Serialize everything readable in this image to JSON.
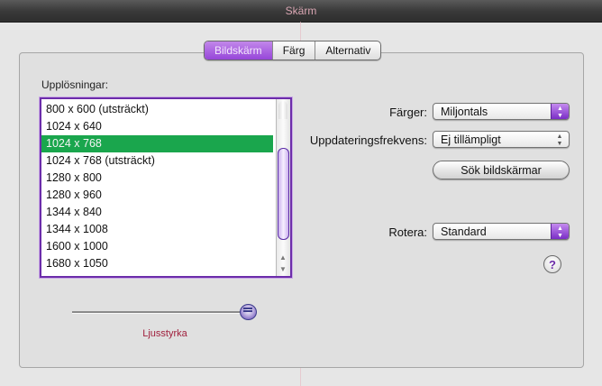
{
  "window": {
    "title": "Skärm"
  },
  "tabs": [
    {
      "label": "Bildskärm",
      "active": true
    },
    {
      "label": "Färg",
      "active": false
    },
    {
      "label": "Alternativ",
      "active": false
    }
  ],
  "resolutions": {
    "label": "Upplösningar:",
    "selected": "1024 x 768",
    "items": [
      "800 x 600 (utsträckt)",
      "1024 x 640",
      "1024 x 768",
      "1024 x 768 (utsträckt)",
      "1280 x 800",
      "1280 x 960",
      "1344 x 840",
      "1344 x 1008",
      "1600 x 1000",
      "1680 x 1050"
    ]
  },
  "brightness": {
    "label": "Ljusstyrka",
    "value_fraction": 1.0
  },
  "colors": {
    "label": "Färger:",
    "value": "Miljontals"
  },
  "refresh": {
    "label": "Uppdateringsfrekvens:",
    "value": "Ej tillämpligt"
  },
  "detect_button": {
    "label": "Sök bildskärmar"
  },
  "rotate": {
    "label": "Rotera:",
    "value": "Standard"
  },
  "help": {
    "label": "?"
  },
  "theme": {
    "accent": "#9646d9",
    "selection": "#1aa64d"
  }
}
